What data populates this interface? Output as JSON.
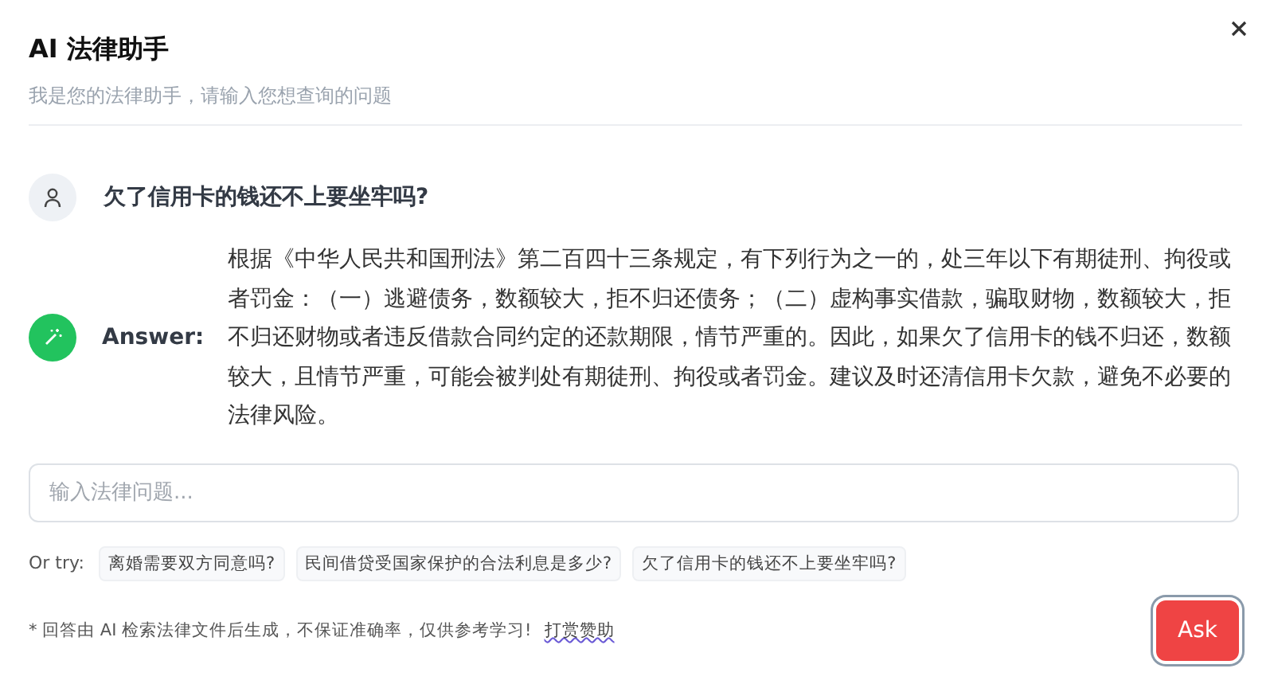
{
  "dialog": {
    "title": "AI 法律助手",
    "subtitle": "我是您的法律助手，请输入您想查询的问题"
  },
  "question": {
    "text": "欠了信用卡的钱还不上要坐牢吗?"
  },
  "answer": {
    "label": "Answer:",
    "text": "根据《中华人民共和国刑法》第二百四十三条规定，有下列行为之一的，处三年以下有期徒刑、拘役或者罚金：（一）逃避债务，数额较大，拒不归还债务；（二）虚构事实借款，骗取财物，数额较大，拒不归还财物或者违反借款合同约定的还款期限，情节严重的。因此，如果欠了信用卡的钱不归还，数额较大，且情节严重，可能会被判处有期徒刑、拘役或者罚金。建议及时还清信用卡欠款，避免不必要的法律风险。"
  },
  "input": {
    "placeholder": "输入法律问题..."
  },
  "suggestions": {
    "label": "Or try:",
    "items": [
      "离婚需要双方同意吗?",
      "民间借贷受国家保护的合法利息是多少?",
      "欠了信用卡的钱还不上要坐牢吗?"
    ]
  },
  "footer": {
    "disclaimer": "* 回答由 AI 检索法律文件后生成，不保证准确率，仅供参考学习!",
    "link": "打赏赞助"
  },
  "ask_button": {
    "label": "Ask"
  }
}
